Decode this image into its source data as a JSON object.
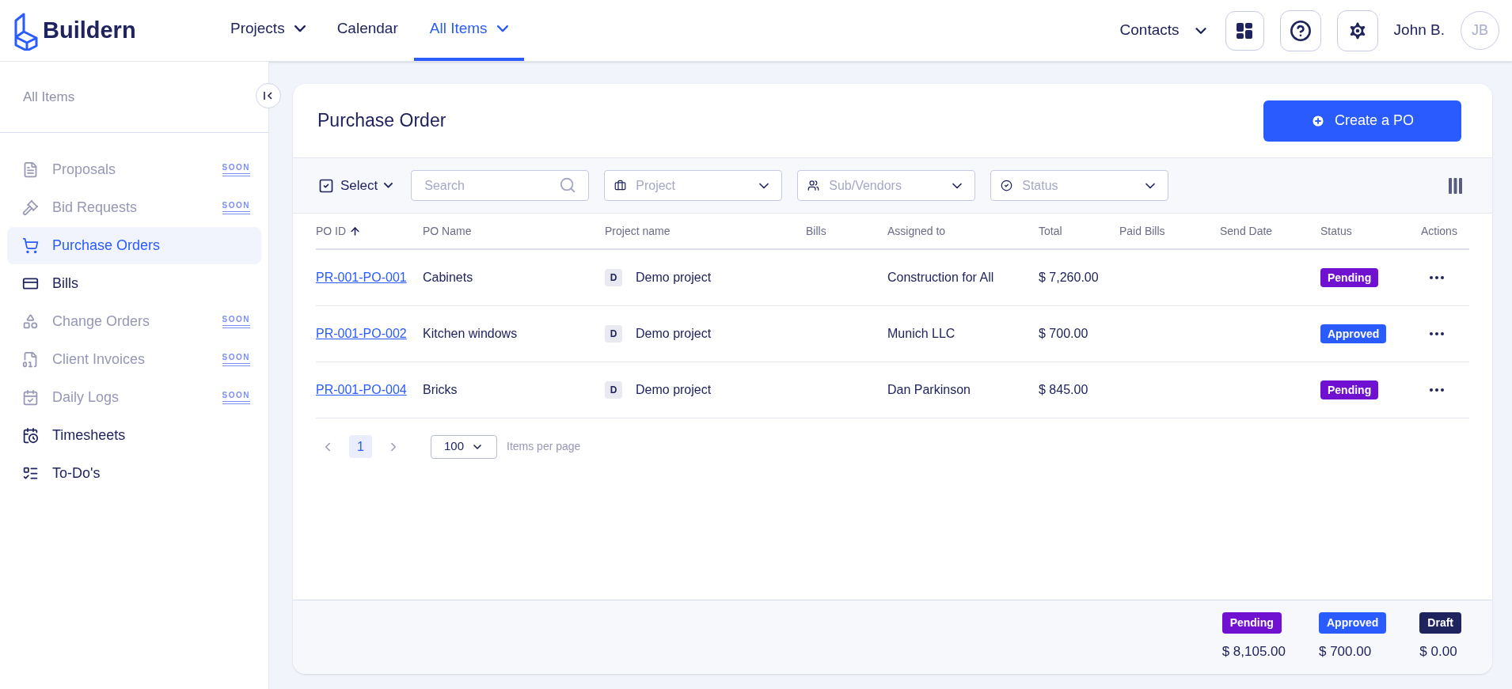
{
  "header": {
    "logo": "Buildern",
    "nav": [
      {
        "label": "Projects",
        "dropdown": true,
        "selected": false
      },
      {
        "label": "Calendar",
        "dropdown": false,
        "selected": false
      },
      {
        "label": "All Items",
        "dropdown": true,
        "selected": true
      }
    ],
    "contacts": "Contacts",
    "user_name": "John B.",
    "avatar": "JB"
  },
  "sidebar": {
    "title": "All Items",
    "items": [
      {
        "label": "Proposals",
        "disabled": true,
        "selected": false,
        "badge": "SOON"
      },
      {
        "label": "Bid Requests",
        "disabled": true,
        "selected": false,
        "badge": "SOON"
      },
      {
        "label": "Purchase Orders",
        "disabled": false,
        "selected": true
      },
      {
        "label": "Bills",
        "disabled": false,
        "selected": false
      },
      {
        "label": "Change Orders",
        "disabled": true,
        "selected": false,
        "badge": "SOON"
      },
      {
        "label": "Client Invoices",
        "disabled": true,
        "selected": false,
        "badge": "SOON"
      },
      {
        "label": "Daily Logs",
        "disabled": true,
        "selected": false,
        "badge": "SOON"
      },
      {
        "label": "Timesheets",
        "disabled": false,
        "selected": false
      },
      {
        "label": "To-Do's",
        "disabled": false,
        "selected": false
      }
    ]
  },
  "page": {
    "title": "Purchase Order",
    "create_button": "Create a PO"
  },
  "toolbar": {
    "select": "Select",
    "search_placeholder": "Search",
    "filters": [
      "Project",
      "Sub/Vendors",
      "Status"
    ]
  },
  "table": {
    "columns": [
      "PO ID",
      "PO Name",
      "Project name",
      "Bills",
      "Assigned to",
      "Total",
      "Paid Bills",
      "Send Date",
      "Status",
      "Actions"
    ],
    "rows": [
      {
        "po_id": "PR-001-PO-001",
        "po_name": "Cabinets",
        "project_initial": "D",
        "project": "Demo project",
        "assigned_to": "Construction for All",
        "total": "$ 7,260.00",
        "status": {
          "label": "Pending",
          "color": "#7010d0"
        }
      },
      {
        "po_id": "PR-001-PO-002",
        "po_name": "Kitchen windows",
        "project_initial": "D",
        "project": "Demo project",
        "assigned_to": "Munich LLC",
        "total": "$ 700.00",
        "status": {
          "label": "Approved",
          "color": "#2a5bff"
        }
      },
      {
        "po_id": "PR-001-PO-004",
        "po_name": "Bricks",
        "project_initial": "D",
        "project": "Demo project",
        "assigned_to": "Dan Parkinson",
        "total": "$ 845.00",
        "status": {
          "label": "Pending",
          "color": "#7010d0"
        }
      }
    ]
  },
  "pagination": {
    "pages": [
      {
        "label": "1",
        "selected": true
      }
    ],
    "page_size": "100",
    "page_size_label": "Items per page"
  },
  "totals": [
    {
      "label": "Pending",
      "color": "#7010d0",
      "amount": "$ 8,105.00"
    },
    {
      "label": "Approved",
      "color": "#2a5bff",
      "amount": "$ 700.00"
    },
    {
      "label": "Draft",
      "color": "#20245e",
      "amount": "$ 0.00"
    }
  ]
}
